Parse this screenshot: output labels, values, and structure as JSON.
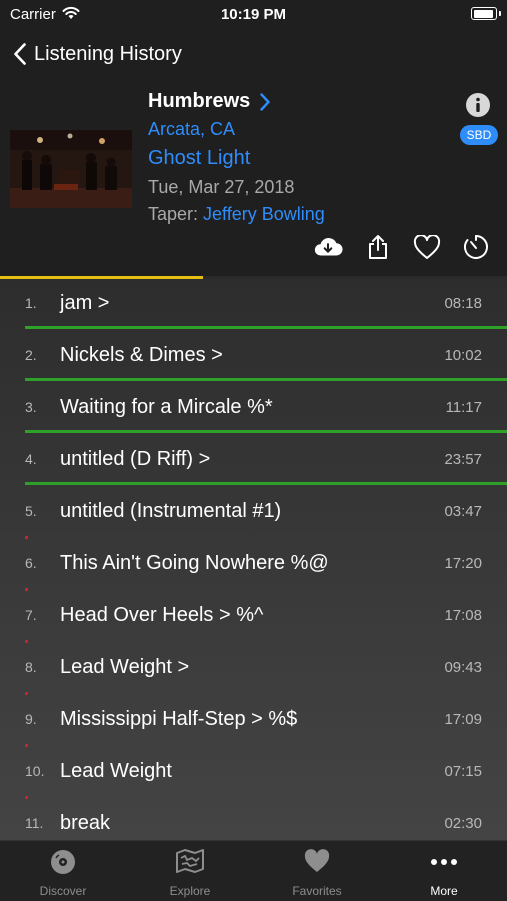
{
  "status_bar": {
    "carrier": "Carrier",
    "time": "10:19 PM"
  },
  "nav": {
    "back_label": "Listening History"
  },
  "show": {
    "band": "Humbrews",
    "location": "Arcata, CA",
    "venue": "Ghost Light",
    "date": "Tue, Mar 27, 2018",
    "taper_label": "Taper:",
    "taper_name": "Jeffery Bowling",
    "source_badge": "SBD",
    "artwork_icon": "band-photo",
    "info_icon": "info-icon"
  },
  "actions": [
    "download-icon",
    "share-icon",
    "heart-icon",
    "timer-icon"
  ],
  "show_progress": 0.4,
  "tracks": [
    {
      "number": "1.",
      "title": "jam >",
      "duration": "08:18",
      "progress": 1.0
    },
    {
      "number": "2.",
      "title": "Nickels & Dimes >",
      "duration": "10:02",
      "progress": 1.0
    },
    {
      "number": "3.",
      "title": "Waiting for a Mircale %*",
      "duration": "11:17",
      "progress": 1.0
    },
    {
      "number": "4.",
      "title": "untitled (D Riff) >",
      "duration": "23:57",
      "progress": 1.0
    },
    {
      "number": "5.",
      "title": "untitled (Instrumental #1)",
      "duration": "03:47",
      "progress": 0
    },
    {
      "number": "6.",
      "title": "This Ain't Going Nowhere %@",
      "duration": "17:20",
      "progress": 0
    },
    {
      "number": "7.",
      "title": "Head Over Heels > %^",
      "duration": "17:08",
      "progress": 0
    },
    {
      "number": "8.",
      "title": "Lead Weight >",
      "duration": "09:43",
      "progress": 0
    },
    {
      "number": "9.",
      "title": "Mississippi Half-Step > %$",
      "duration": "17:09",
      "progress": 0
    },
    {
      "number": "10.",
      "title": "Lead Weight",
      "duration": "07:15",
      "progress": 0
    },
    {
      "number": "11.",
      "title": "break",
      "duration": "02:30",
      "progress": 0
    }
  ],
  "tabs": [
    {
      "label": "Discover",
      "icon": "disc-icon",
      "active": false
    },
    {
      "label": "Explore",
      "icon": "map-icon",
      "active": false
    },
    {
      "label": "Favorites",
      "icon": "heart-icon",
      "active": false
    },
    {
      "label": "More",
      "icon": "ellipsis-icon",
      "active": true
    }
  ],
  "colors": {
    "accent": "#2f8dfb",
    "played": "#2fa02a",
    "show_progress": "#e5be12",
    "marker": "#c0282a",
    "background": "#2a2a2a",
    "header": "#1f1f1f"
  }
}
